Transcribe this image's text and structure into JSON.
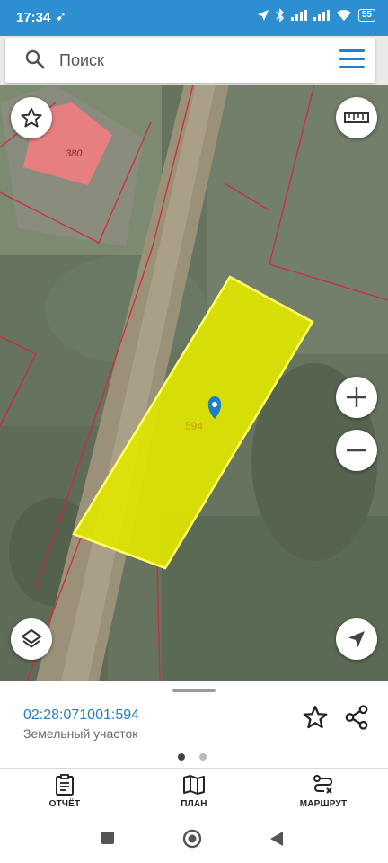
{
  "status_bar": {
    "time": "17:34",
    "battery": "55"
  },
  "search": {
    "placeholder": "Поиск",
    "value": ""
  },
  "map": {
    "parcel_label": "594",
    "house_label": "380"
  },
  "bottom_sheet": {
    "cadastral_number": "02:28:071001:594",
    "object_type": "Земельный участок",
    "page_count": 2,
    "active_page": 1
  },
  "tabs": [
    {
      "label": "ОТЧЁТ",
      "icon": "report-icon"
    },
    {
      "label": "ПЛАН",
      "icon": "map-plan-icon"
    },
    {
      "label": "МАРШРУТ",
      "icon": "route-icon"
    }
  ],
  "colors": {
    "status_bar": "#2e8fd0",
    "accent": "#1f7fc7",
    "parcel_fill": "#e1e600",
    "parcel_border": "#ffff66",
    "boundary_lines": "#d2283a",
    "building": "#e77f80"
  }
}
